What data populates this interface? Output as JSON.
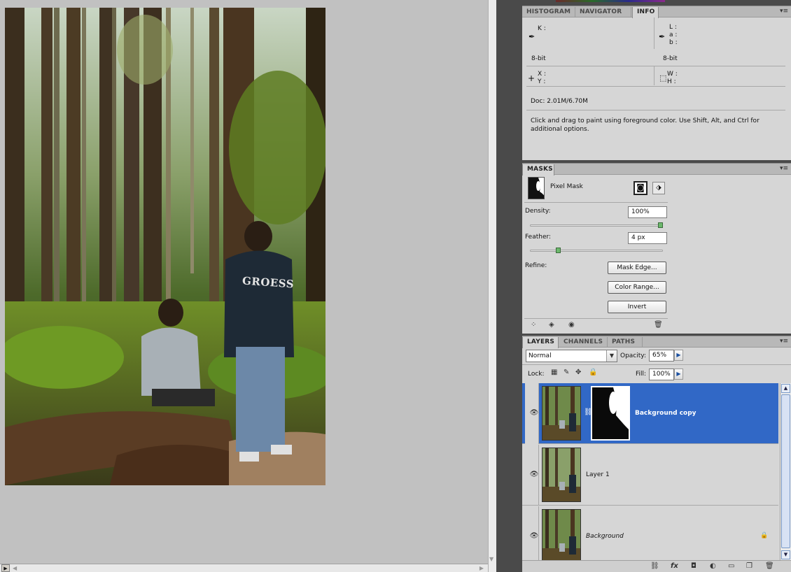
{
  "info_panel": {
    "tabs": [
      "HISTOGRAM",
      "NAVIGATOR",
      "INFO"
    ],
    "active_tab": "INFO",
    "k_label": "K :",
    "lab_l": "L :",
    "lab_a": "a :",
    "lab_b": "b :",
    "bit_left": "8-bit",
    "bit_right": "8-bit",
    "x_label": "X :",
    "y_label": "Y :",
    "w_label": "W :",
    "h_label": "H :",
    "doc": "Doc: 2.01M/6.70M",
    "hint": "Click and drag to paint using foreground color.  Use Shift, Alt, and Ctrl for additional options."
  },
  "masks_panel": {
    "tab": "MASKS",
    "mask_type": "Pixel Mask",
    "density_label": "Density:",
    "density_value": "100%",
    "density_level": 1.0,
    "feather_label": "Feather:",
    "feather_value": "4 px",
    "feather_level": 0.2,
    "refine_label": "Refine:",
    "mask_edge_button": "Mask Edge...",
    "color_range_button": "Color Range...",
    "invert_button": "Invert"
  },
  "layers_panel": {
    "tabs": [
      "LAYERS",
      "CHANNELS",
      "PATHS"
    ],
    "active_tab": "LAYERS",
    "blend_mode": "Normal",
    "opacity_label": "Opacity:",
    "opacity_value": "65%",
    "lock_label": "Lock:",
    "fill_label": "Fill:",
    "fill_value": "100%",
    "layers": [
      {
        "name": "Background copy",
        "selected": true,
        "has_mask": true
      },
      {
        "name": "Layer 1",
        "selected": false,
        "has_mask": false
      },
      {
        "name": "Background",
        "selected": false,
        "has_mask": false,
        "locked": true
      }
    ]
  },
  "canvas": {
    "jacket_text": "GROESS"
  },
  "colors": {
    "selection": "#3168c6",
    "panel_bg": "#d6d6d6",
    "canvas_bg": "#c1c1c1"
  }
}
